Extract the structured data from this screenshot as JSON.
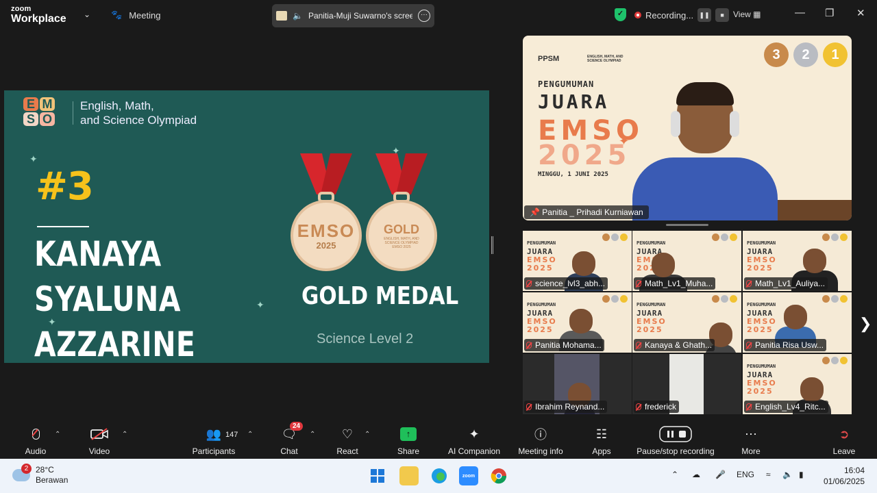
{
  "titlebar": {
    "brand_top": "zoom",
    "brand_bottom": "Workplace",
    "meeting_label": "Meeting",
    "share_label": "Panitia-Muji Suwarno's screen",
    "recording_label": "Recording...",
    "view_label": "View"
  },
  "slide": {
    "logo_letters": [
      "E",
      "M",
      "S",
      "O"
    ],
    "olympiad_line1": "English, Math,",
    "olympiad_line2": "and Science Olympiad",
    "rank": "#3",
    "winner_line1": "KANAYA SYALUNA",
    "winner_line2": "AZZARINE",
    "medal_left_year": "2025",
    "medal_left_letters": "EMSO",
    "medal_right_title": "GOLD",
    "medal_right_sub": "ENGLISH, MATH, AND SCIENCE OLYMPIAD",
    "medal_right_year": "EMSO 2025",
    "medal_label": "GOLD MEDAL",
    "level": "Science Level 2"
  },
  "speaker": {
    "brand": "PPSM",
    "brand_sub": "ENGLISH, MATH, AND SCIENCE OLYMPIAD",
    "title_1": "PENGUMUMAN",
    "title_2": "JUARA",
    "title_3": "EMSO",
    "title_4": "2025",
    "date": "MINGGU, 1 JUNI 2025",
    "medal_numbers": [
      "3",
      "2",
      "1"
    ],
    "name": "Panitia _ Prihadi Kurniawan"
  },
  "gallery": [
    {
      "name": "science_lvl3_abh...",
      "bg": "title"
    },
    {
      "name": "Math_Lv1_Muha...",
      "bg": "title"
    },
    {
      "name": "Math_Lv1_Auliya...",
      "bg": "title"
    },
    {
      "name": "Panitia Mohama...",
      "bg": "title"
    },
    {
      "name": "Kanaya & Ghath...",
      "bg": "title"
    },
    {
      "name": "Panitia Risa Usw...",
      "bg": "title"
    },
    {
      "name": "Ibrahim Reynand...",
      "bg": "room"
    },
    {
      "name": "frederick",
      "bg": "room"
    },
    {
      "name": "English_Lv4_Ritc...",
      "bg": "title"
    }
  ],
  "gallery_tile_text": {
    "t1": "PENGUMUMAN",
    "t2": "JUARA",
    "t3": "EMSO",
    "t4": "2025"
  },
  "toolbar": {
    "audio": "Audio",
    "video": "Video",
    "participants": "Participants",
    "participants_count": "147",
    "chat": "Chat",
    "chat_badge": "24",
    "react": "React",
    "share": "Share",
    "ai_companion": "AI Companion",
    "meeting_info": "Meeting info",
    "apps": "Apps",
    "pause_recording": "Pause/stop recording",
    "more": "More",
    "leave": "Leave"
  },
  "taskbar": {
    "weather_badge": "2",
    "temperature": "28°C",
    "condition": "Berawan",
    "lang": "ENG",
    "time": "16:04",
    "date": "01/06/2025"
  },
  "colors": {
    "slide_bg": "#1f5a55",
    "rank_yellow": "#f6c21b",
    "ribbon_red": "#d7262c",
    "share_green": "#1fbf5a",
    "leave_red": "#e04a4a"
  }
}
